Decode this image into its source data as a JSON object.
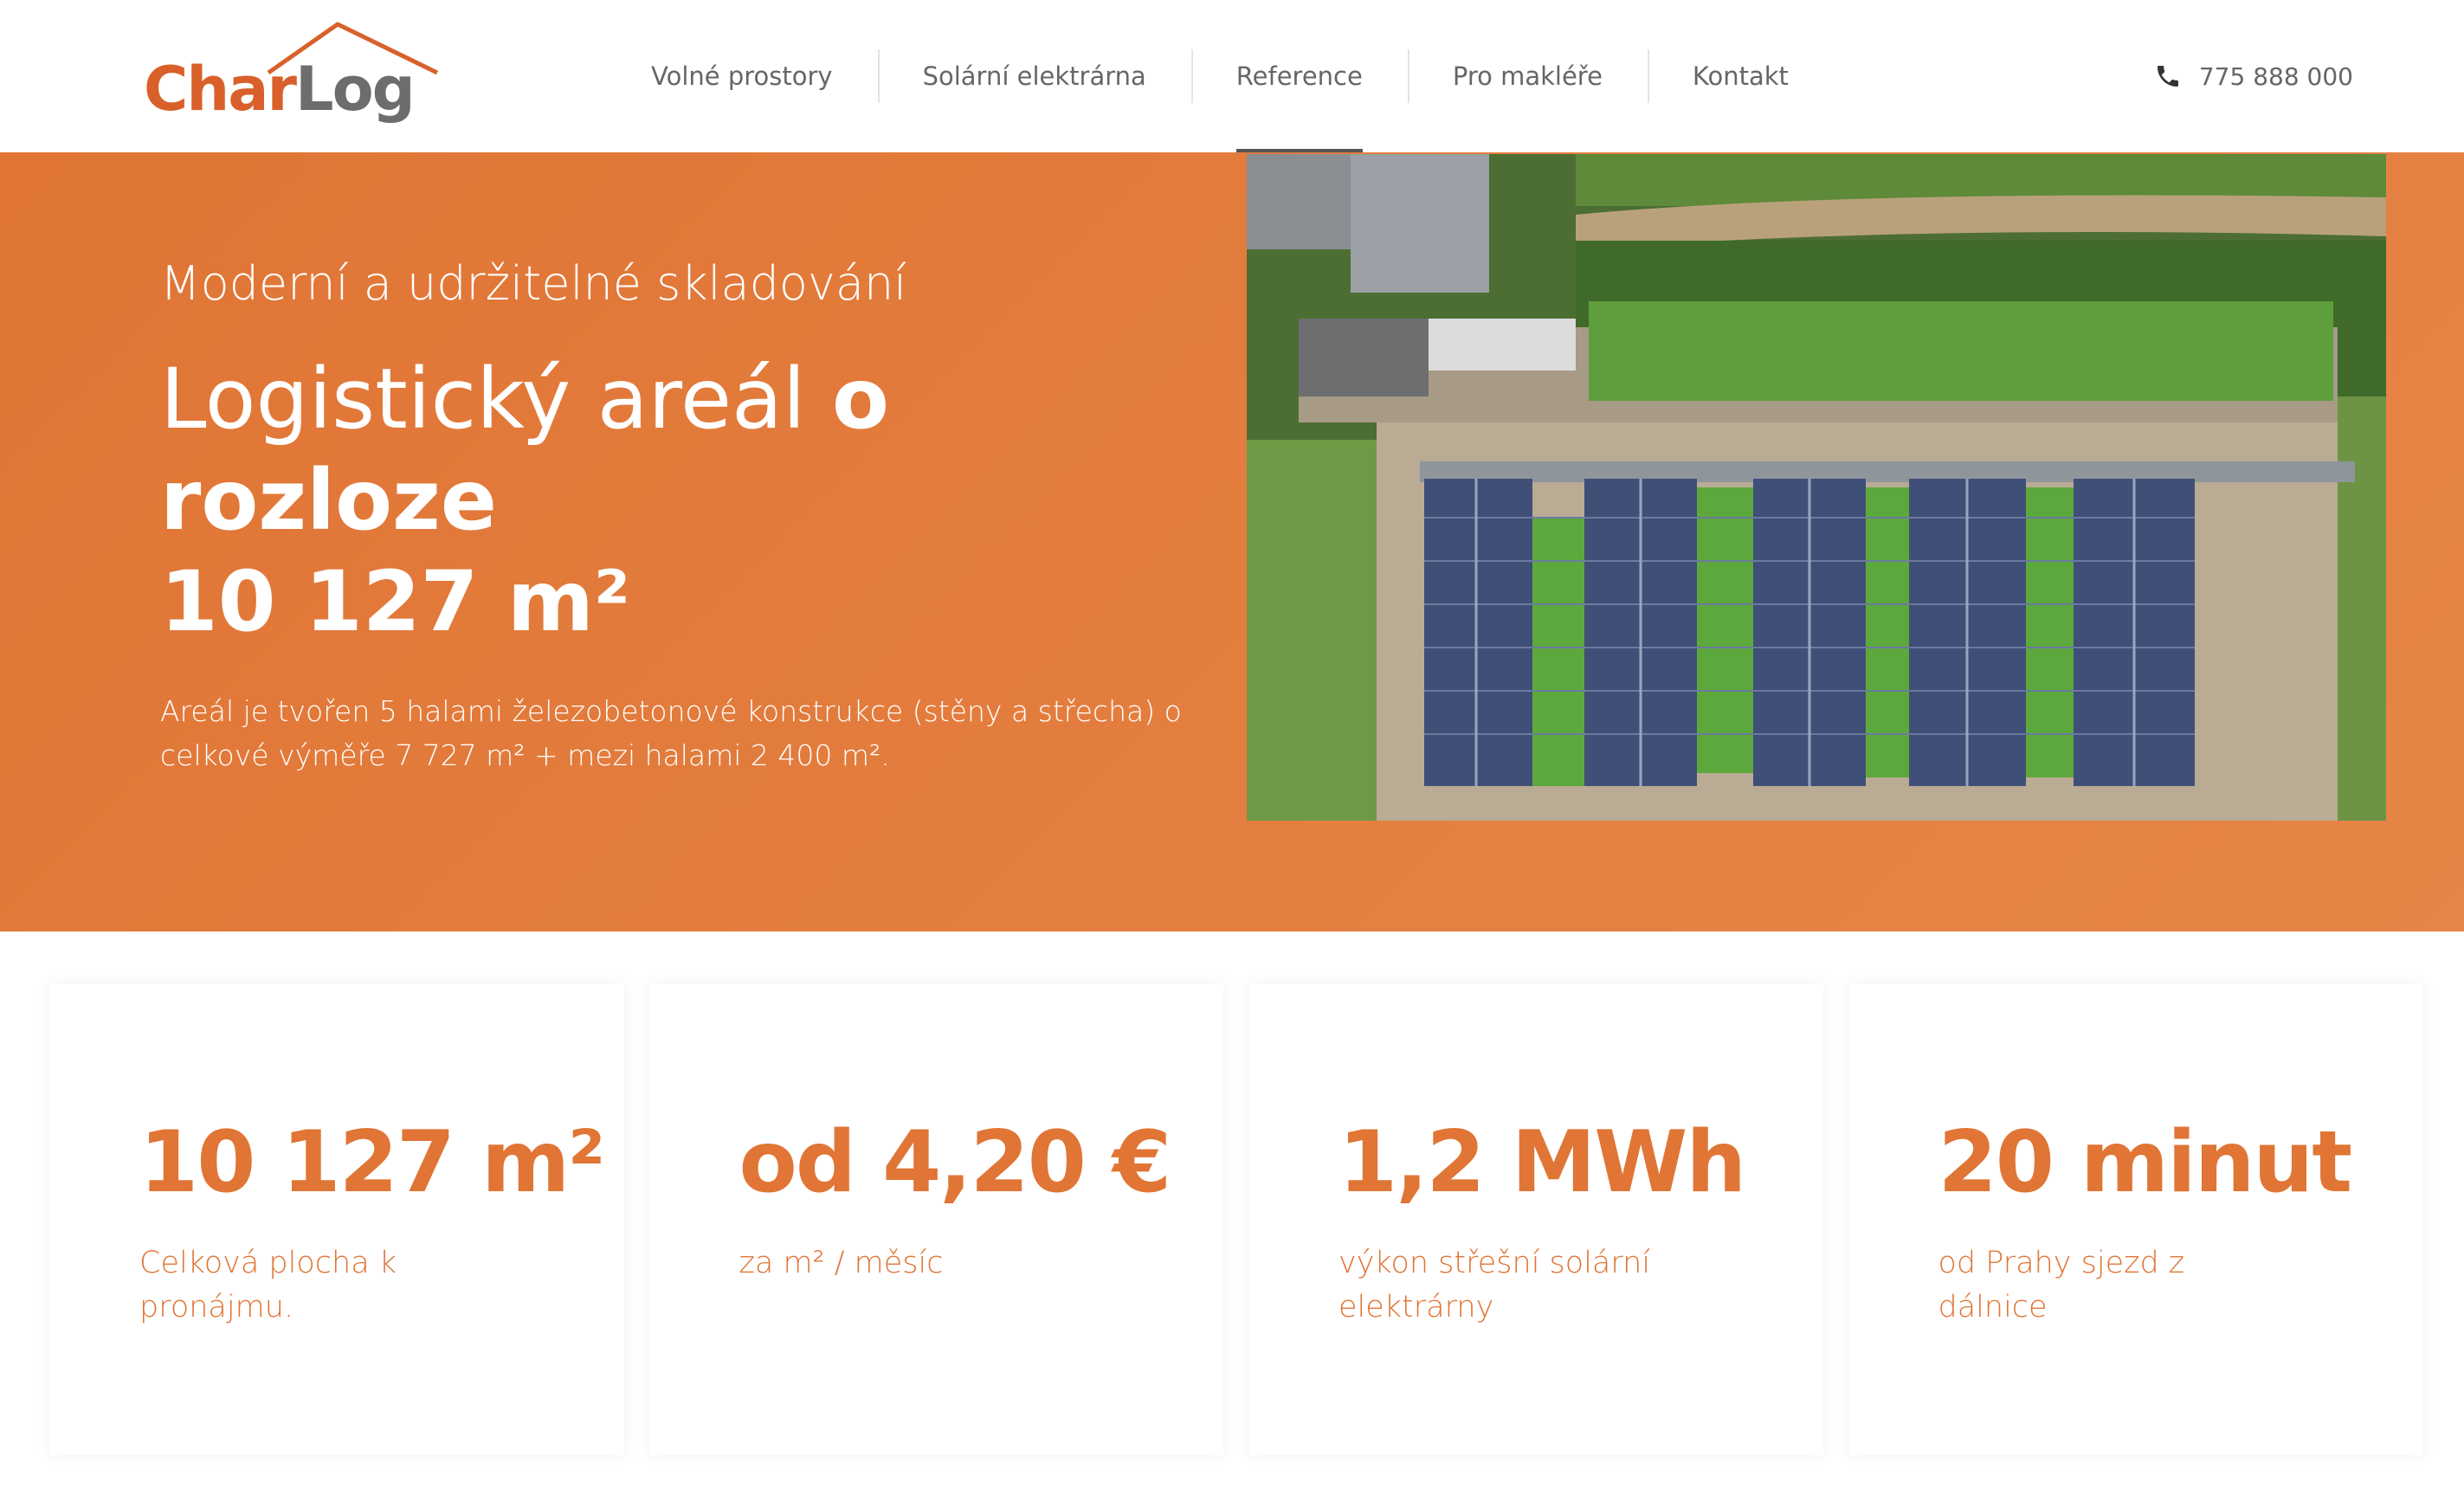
{
  "brand": {
    "part1": "Char",
    "part2": "Log",
    "primary_color": "#e07535",
    "secondary_color": "#6d6d6d"
  },
  "nav": {
    "items": [
      {
        "label": "Volné prostory"
      },
      {
        "label": "Solární elektrárna"
      },
      {
        "label": "Reference",
        "active": true
      },
      {
        "label": "Pro makléře"
      },
      {
        "label": "Kontakt"
      }
    ]
  },
  "contact": {
    "phone": "775 888 000",
    "icon": "phone-icon"
  },
  "hero": {
    "kicker": "Moderní a udržitelné skladování",
    "title_regular": "Logistický areál ",
    "title_bold": "o rozloze",
    "title_line2": "10 127 m²",
    "description": "Areál je tvořen 5 halami železobetonové konstrukce (stěny a střecha) o celkové výměře 7 727 m² + mezi halami 2 400 m².",
    "background": "#e07535"
  },
  "stats": [
    {
      "value": "10 127 m²",
      "label": "Celková plocha k pronájmu."
    },
    {
      "value": "od 4,20 €",
      "label": "za m² / měsíc"
    },
    {
      "value": "1,2 MWh",
      "label": "výkon střešní solární elektrárny"
    },
    {
      "value": "20 minut",
      "label": "od Prahy sjezd z dálnice"
    }
  ]
}
